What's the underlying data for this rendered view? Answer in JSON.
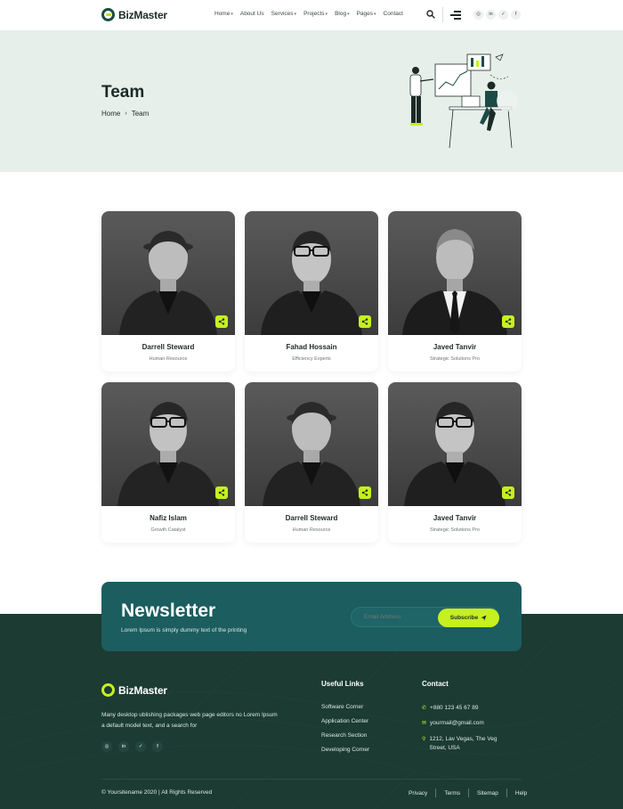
{
  "header": {
    "brand": "BizMaster",
    "nav": [
      {
        "label": "Home",
        "has_dropdown": true
      },
      {
        "label": "About Us",
        "has_dropdown": false
      },
      {
        "label": "Services",
        "has_dropdown": true
      },
      {
        "label": "Projects",
        "has_dropdown": true
      },
      {
        "label": "Blog",
        "has_dropdown": true
      },
      {
        "label": "Pages",
        "has_dropdown": true
      },
      {
        "label": "Contact",
        "has_dropdown": false
      }
    ],
    "social": [
      "instagram-icon",
      "linkedin-icon",
      "twitter-icon",
      "facebook-icon"
    ]
  },
  "hero": {
    "title": "Team",
    "breadcrumb": [
      "Home",
      "Team"
    ]
  },
  "team": [
    {
      "name": "Darrell Steward",
      "role": "Human Resource"
    },
    {
      "name": "Fahad Hossain",
      "role": "Efficiency Experts"
    },
    {
      "name": "Javed Tanvir",
      "role": "Strategic Solutions Pro"
    },
    {
      "name": "Nafiz Islam",
      "role": "Growth Catalyst"
    },
    {
      "name": "Darrell Steward",
      "role": "Human Resource"
    },
    {
      "name": "Javed Tanvir",
      "role": "Strategic Solutions Pro"
    }
  ],
  "newsletter": {
    "title": "Newsletter",
    "subtitle": "Lorem Ipsum is simply dummy text of the printing",
    "input_placeholder": "Email Address",
    "button": "Subscribe"
  },
  "footer": {
    "brand": "BizMaster",
    "about": "Many desktop ublishing packages web page editors no Lorem Ipsum a default model text, and a search for",
    "useful_links_title": "Useful Links",
    "useful_links": [
      "Software Corner",
      "Application Center",
      "Research Section",
      "Developing Corner"
    ],
    "contact_title": "Contact",
    "phone": "+880 123 45 67 89",
    "email": "yourmail@gmail.com",
    "address": "1212, Lav Vegas, The Veg Street, USA",
    "copyright": "© Yoursitename 2020 | All Rights Reserved",
    "bottom_links": [
      "Privacy",
      "Terms",
      "Sitemap",
      "Help"
    ]
  },
  "colors": {
    "accent": "#c6f01f",
    "brand_dark": "#1b4c44",
    "hero_bg": "#e7efeb",
    "newsletter_bg": "#1c5d5f",
    "footer_bg": "#1b3b33"
  }
}
